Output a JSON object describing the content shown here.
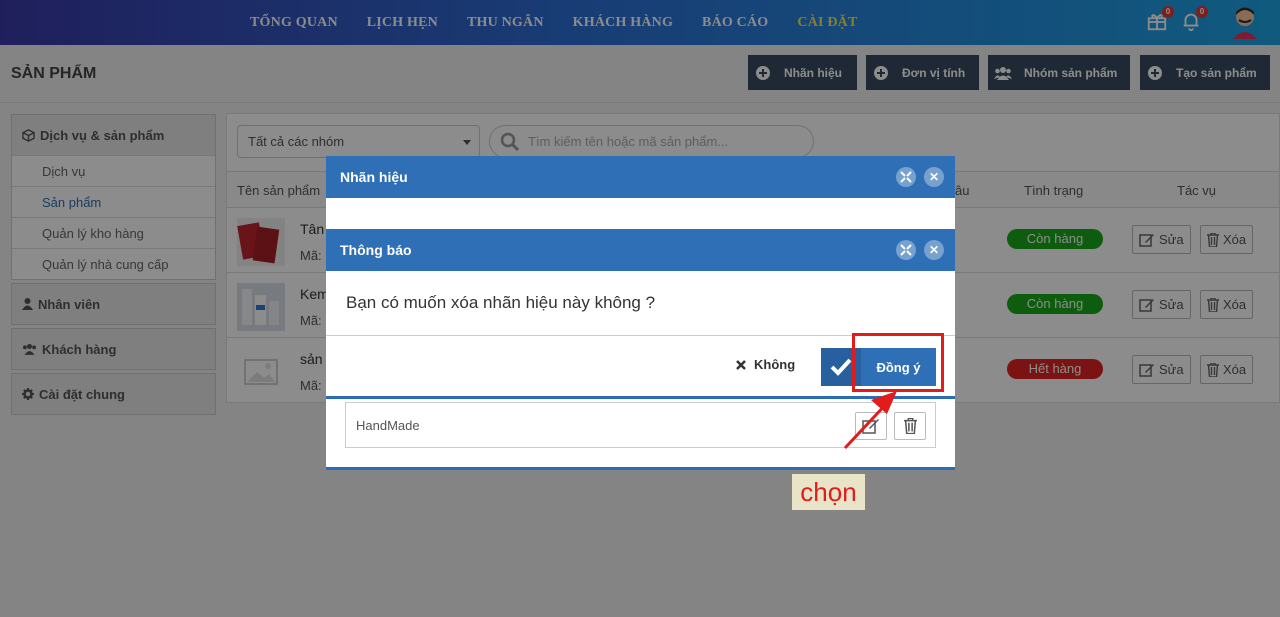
{
  "nav": {
    "items": [
      "TỔNG QUAN",
      "LỊCH HẸN",
      "THU NGÂN",
      "KHÁCH HÀNG",
      "BÁO CÁO",
      "CÀI ĐẶT"
    ],
    "active_index": 5,
    "gift_badge": "0",
    "bell_badge": "0"
  },
  "page": {
    "title": "SẢN PHẨM",
    "buttons": [
      "Nhãn hiệu",
      "Đơn vị tính",
      "Nhóm sản phẩm",
      "Tạo sản phẩm"
    ]
  },
  "sidebar": {
    "group_title": "Dịch vụ & sản phẩm",
    "sub_items": [
      "Dịch vụ",
      "Sản phẩm",
      "Quản lý kho hàng",
      "Quản lý nhà cung cấp"
    ],
    "active_sub": 1,
    "sections": [
      "Nhân viên",
      "Khách hàng",
      "Cài đặt chung"
    ]
  },
  "main": {
    "filter_value": "Tất cả các nhóm",
    "search_placeholder": "Tìm kiếm tên hoặc mã sản phẩm...",
    "columns": {
      "name": "Tên sản phẩm",
      "partial": "âu",
      "status": "Tình trạng",
      "actions": "Tác vụ"
    },
    "rows": [
      {
        "name": "Tân",
        "code": "Mã:",
        "status": "Còn hàng",
        "status_color": "#1aa81a"
      },
      {
        "name": "Kem",
        "code": "Mã:",
        "status": "Còn hàng",
        "status_color": "#1aa81a"
      },
      {
        "name": "sản",
        "code": "Mã:",
        "status": "Hết hàng",
        "status_color": "#e02424"
      }
    ],
    "edit_label": "Sửa",
    "delete_label": "Xóa"
  },
  "dialog_brand": {
    "title": "Nhãn hiệu",
    "row_text": "HandMade"
  },
  "dialog_confirm": {
    "title": "Thông báo",
    "message": "Bạn có muốn xóa nhãn hiệu này không ?",
    "no_label": "Không",
    "yes_label": "Đồng ý"
  },
  "annotation": {
    "label": "chọn",
    "color": "#e21b1b"
  }
}
